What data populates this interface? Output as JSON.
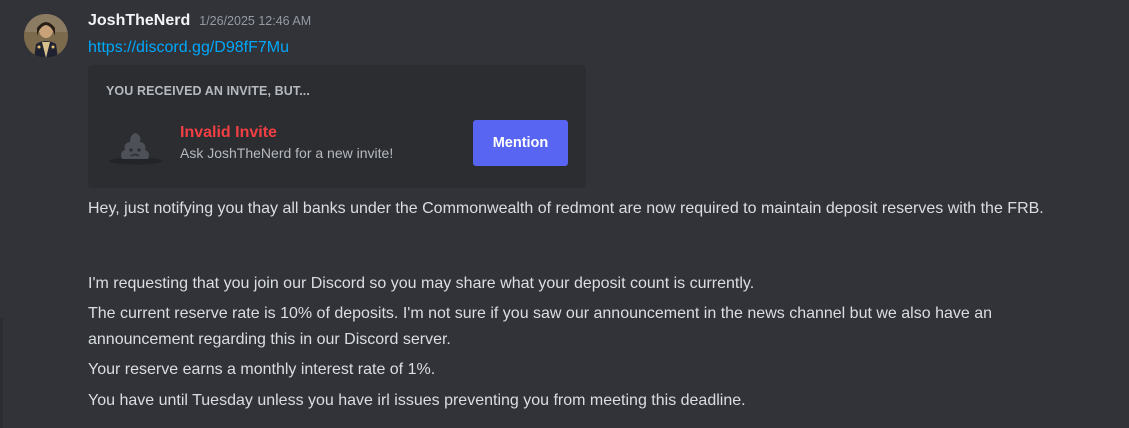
{
  "message": {
    "author": "JoshTheNerd",
    "timestamp": "1/26/2025 12:46 AM",
    "link": "https://discord.gg/D98fF7Mu"
  },
  "invite": {
    "heading": "YOU RECEIVED AN INVITE, BUT...",
    "title": "Invalid Invite",
    "subtitle": "Ask JoshTheNerd for a new invite!",
    "button_label": "Mention",
    "icon": "sad-poop-icon"
  },
  "body": {
    "line1": "Hey, just notifying you thay all banks under the Commonwealth of redmont are now required to maintain deposit reserves with the FRB.",
    "line2": "I'm requesting that you join our Discord so you may share what your deposit count is currently.",
    "line3": "The current reserve rate is 10% of deposits. I'm not sure if you saw our announcement in the news channel but we also have an announcement regarding this in our Discord server.",
    "line4": "Your reserve earns a monthly interest rate of 1%.",
    "line5": "You have until Tuesday unless you have irl issues preventing you from meeting this deadline."
  },
  "colors": {
    "background": "#313338",
    "embed_background": "#2b2d31",
    "link": "#00a8fc",
    "error": "#f23f43",
    "button": "#5865f2"
  }
}
